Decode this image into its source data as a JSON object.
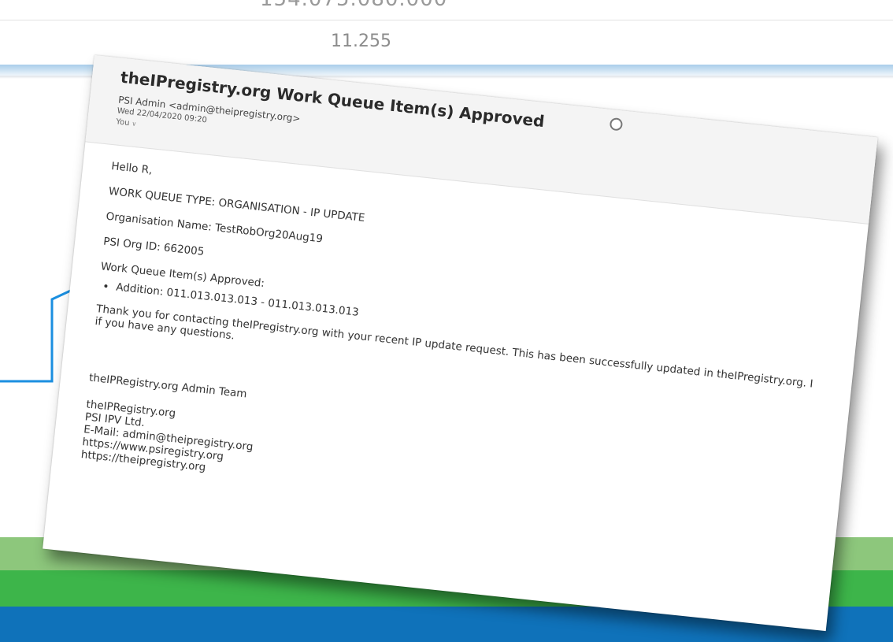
{
  "background": {
    "top_text": "154.075.080.000",
    "second_text": "11.255",
    "band_colors": {
      "light_green": "#8dc77c",
      "green": "#3db54a",
      "blue": "#0f72ba"
    },
    "callout_color": "#1b8fe0"
  },
  "email": {
    "subject": "theIPregistry.org Work Queue Item(s) Approved",
    "sender": "PSI Admin <admin@theipregistry.org>",
    "date": "Wed 22/04/2020 09:20",
    "to": "You",
    "greeting": "Hello R,",
    "work_queue_type": "WORK QUEUE TYPE: ORGANISATION - IP UPDATE",
    "organisation_name": "Organisation Name: TestRobOrg20Aug19",
    "org_id": "PSI Org ID: 662005",
    "approved_heading": "Work Queue Item(s) Approved:",
    "approved_items": [
      "Addition: 011.013.013.013 - 011.013.013.013"
    ],
    "thank_you_line1": "Thank you for contacting theIPregistry.org with your recent IP update request. This has been successfully updated in theIPregistry.org. I",
    "thank_you_line2": "if you have any questions.",
    "signature": {
      "team": "theIPRegistry.org Admin Team",
      "lines": [
        "theIPRegistry.org",
        "PSI IPV Ltd.",
        "E-Mail: admin@theipregistry.org",
        "https://www.psiregistry.org",
        "https://theipregistry.org"
      ]
    }
  }
}
